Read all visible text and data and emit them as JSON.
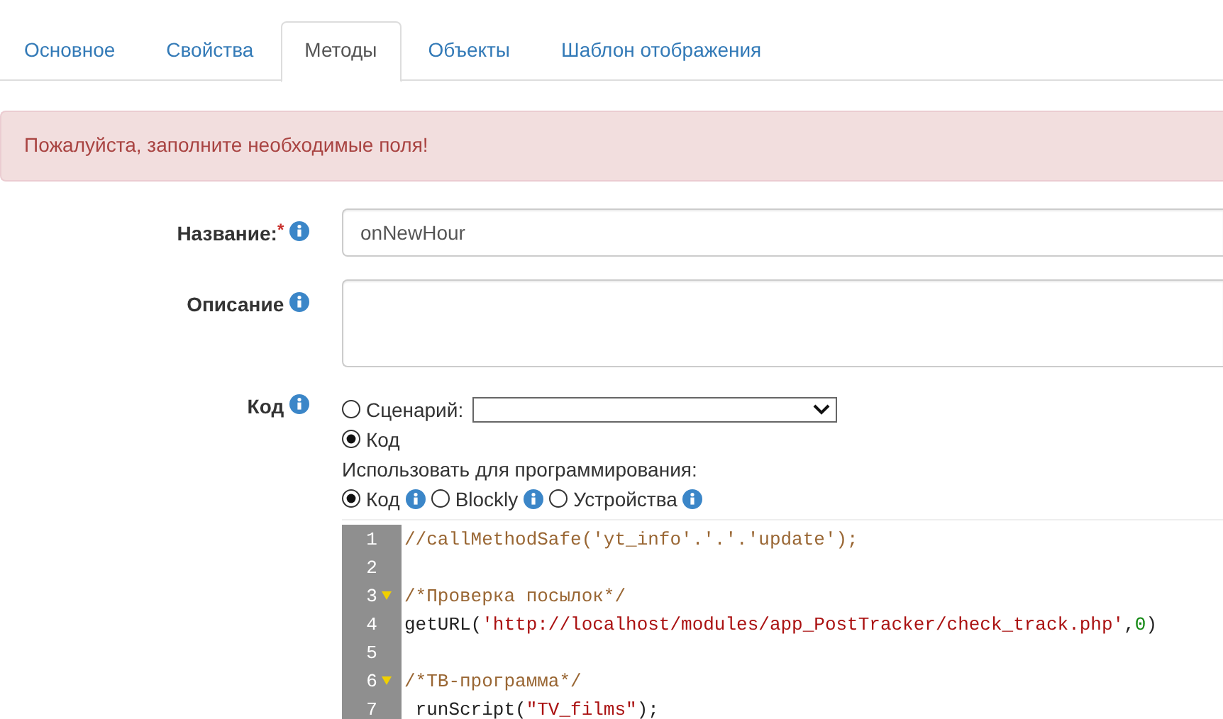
{
  "tabs": [
    {
      "label": "Основное",
      "selected": false
    },
    {
      "label": "Свойства",
      "selected": false
    },
    {
      "label": "Методы",
      "selected": true
    },
    {
      "label": "Объекты",
      "selected": false
    },
    {
      "label": "Шаблон отображения",
      "selected": false
    }
  ],
  "alert": {
    "message": "Пожалуйста, заполните необходимые поля!"
  },
  "form": {
    "name": {
      "label": "Название:",
      "required_mark": "*",
      "info": true,
      "value": "onNewHour"
    },
    "description": {
      "label": "Описание",
      "info": true
    },
    "code": {
      "label": "Код",
      "info": true,
      "source_options": [
        {
          "kind": "select",
          "label": "Сценарий:",
          "selected": false
        },
        {
          "kind": "plain",
          "label": "Код",
          "selected": true
        }
      ],
      "usage_label": "Использовать для программирования:",
      "editor_types": [
        {
          "label": "Код",
          "selected": true,
          "info": true
        },
        {
          "label": "Blockly",
          "selected": false,
          "info": true
        },
        {
          "label": "Устройства",
          "selected": false,
          "info": true
        }
      ],
      "code_lines": [
        {
          "number": "1",
          "fold": false,
          "tokens": [
            {
              "kind": "comment",
              "text": "//callMethodSafe('yt_info'.'.'.'update');"
            }
          ]
        },
        {
          "number": "2",
          "fold": false
        },
        {
          "number": "3",
          "fold": true,
          "tokens": [
            {
              "kind": "comment",
              "text": "/*Проверка посылок*/"
            }
          ]
        },
        {
          "number": "4",
          "fold": false,
          "tokens": [
            {
              "kind": "plain",
              "text": "getURL("
            },
            {
              "kind": "string",
              "text": "'http://localhost/modules/app_PostTracker/check_track.php'"
            },
            {
              "kind": "plain",
              "text": ","
            },
            {
              "kind": "number",
              "text": "0"
            },
            {
              "kind": "plain",
              "text": ")"
            }
          ]
        },
        {
          "number": "5",
          "fold": false
        },
        {
          "number": "6",
          "fold": true,
          "tokens": [
            {
              "kind": "comment",
              "text": "/*ТВ-программа*/"
            }
          ]
        },
        {
          "number": "7",
          "fold": false,
          "tokens": [
            {
              "kind": "plain",
              "text": " runScript("
            },
            {
              "kind": "string",
              "text": "\"TV_films\""
            },
            {
              "kind": "plain",
              "text": ");"
            }
          ]
        }
      ]
    }
  }
}
